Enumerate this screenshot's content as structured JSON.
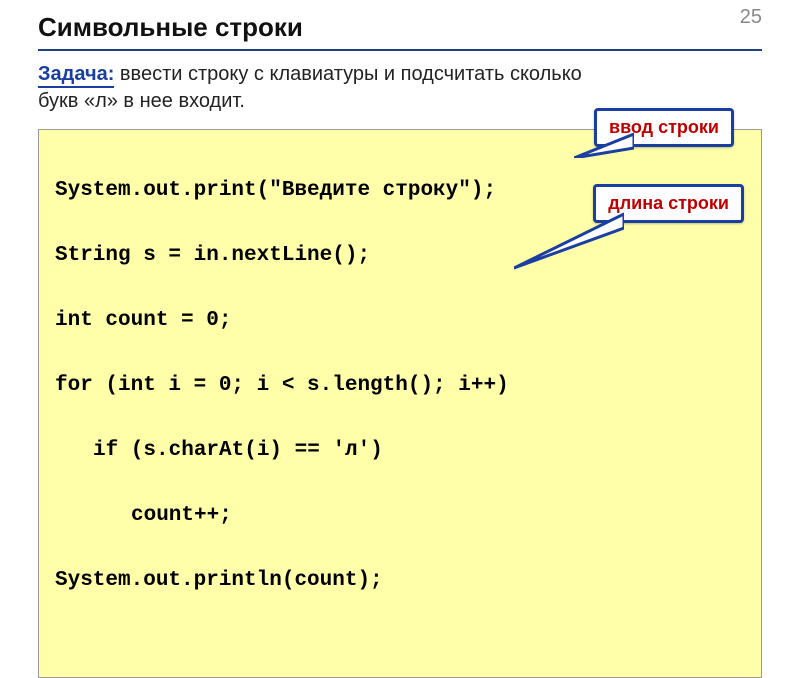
{
  "page_number": "25",
  "title": "Символьные строки",
  "task_label": "Задача:",
  "task_text": " ввести строку с клавиатуры и подсчитать сколько букв «л» в нее входит.",
  "code": {
    "l1": "System.out.print(\"Введите строку\");",
    "l2": "String s = in.nextLine();",
    "l3": "int count = 0;",
    "l4": "for (int i = 0; i < s.length(); i++)",
    "l5": "if (s.charAt(i) == 'л')",
    "l6": "count++;",
    "l7": "System.out.println(count);"
  },
  "callouts": {
    "input": "ввод строки",
    "length": "длина строки"
  }
}
